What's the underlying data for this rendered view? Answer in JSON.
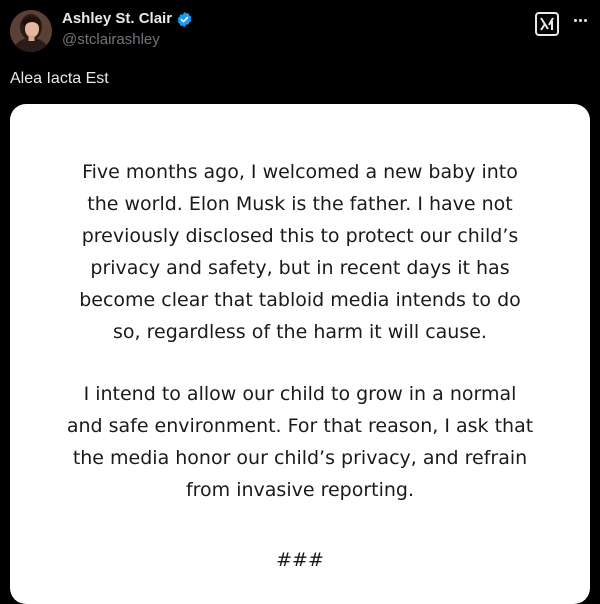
{
  "post": {
    "author": {
      "display_name": "Ashley St. Clair",
      "handle": "@stclairashley",
      "verified": true,
      "avatar_icon": "profile-photo"
    },
    "actions": {
      "grok_icon": "grok-icon",
      "more_icon": "more-options-icon"
    },
    "text": "Alea Iacta Est",
    "image": {
      "paragraph_1": [
        "Five months ago, I welcomed a new baby into",
        "the world. Elon Musk is the father. I have not",
        "previously disclosed this to protect our child’s",
        "privacy and safety, but in recent days it has",
        "become clear that tabloid media intends to do",
        "so, regardless of the harm it will cause."
      ],
      "paragraph_2": [
        "I intend to allow our child to grow in a normal",
        "and safe environment. For that reason, I ask that",
        "the media honor our child’s privacy, and refrain",
        "from invasive reporting."
      ],
      "closing": "###"
    }
  },
  "colors": {
    "background": "#000000",
    "primary_text": "#e7e9ea",
    "secondary_text": "#71767b",
    "verified_badge": "#1d9bf0",
    "card_background": "#ffffff",
    "card_text": "#1a1a1a"
  }
}
